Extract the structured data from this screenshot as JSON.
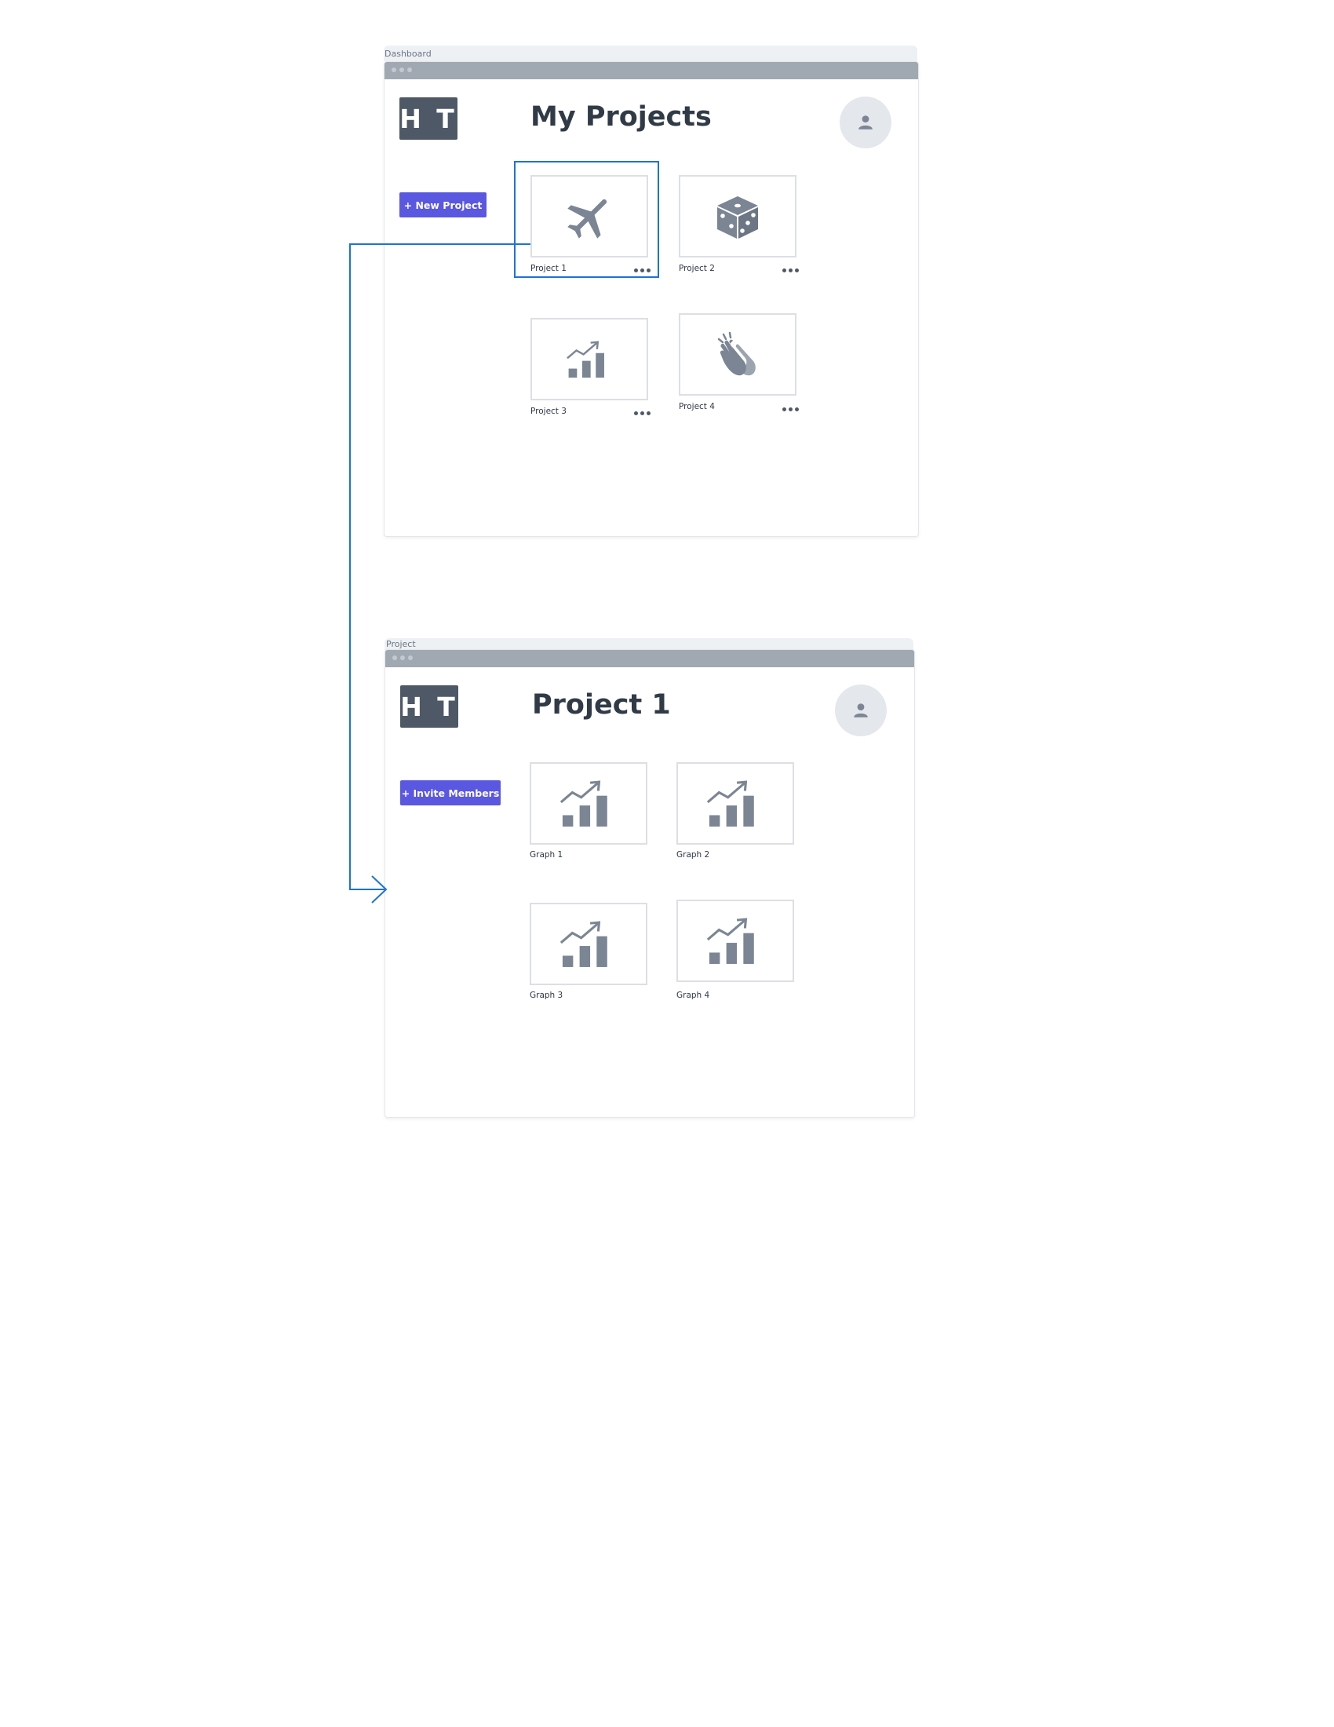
{
  "colors": {
    "accent": "#5a57e0",
    "link": "#1d72d8",
    "icon": "#7b8594",
    "logo_bg": "#4e5866"
  },
  "dashboard": {
    "frame_label": "Dashboard",
    "logo_text": "H T",
    "title": "My Projects",
    "new_button": "+ New Project",
    "projects": [
      {
        "label": "Project 1",
        "icon": "airplane-icon",
        "selected": true
      },
      {
        "label": "Project 2",
        "icon": "dice-icon"
      },
      {
        "label": "Project 3",
        "icon": "bar-chart-trend-icon"
      },
      {
        "label": "Project 4",
        "icon": "clapping-hands-icon"
      }
    ]
  },
  "project": {
    "frame_label": "Project",
    "logo_text": "H T",
    "title": "Project 1",
    "invite_button": "+ Invite Members",
    "graphs": [
      {
        "label": "Graph 1",
        "icon": "bar-chart-trend-icon"
      },
      {
        "label": "Graph 2",
        "icon": "bar-chart-trend-icon"
      },
      {
        "label": "Graph 3",
        "icon": "bar-chart-trend-icon"
      },
      {
        "label": "Graph 4",
        "icon": "bar-chart-trend-icon"
      }
    ]
  },
  "flow": {
    "from": "Project 1",
    "to": "Project"
  }
}
